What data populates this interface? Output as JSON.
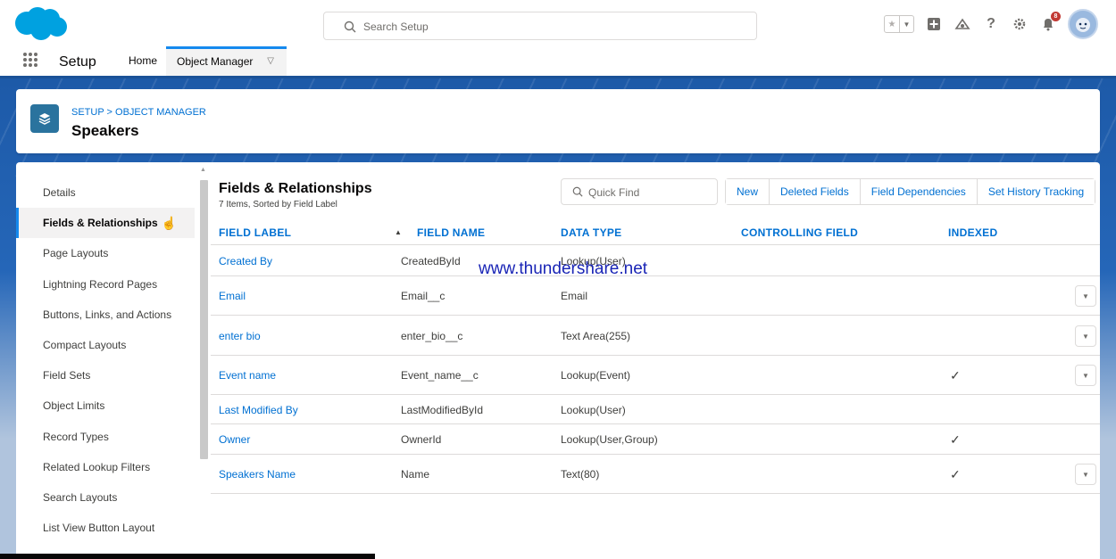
{
  "header": {
    "search_placeholder": "Search Setup",
    "notification_count": "8",
    "help_glyph": "?"
  },
  "nav": {
    "app_name": "Setup",
    "tabs": [
      {
        "label": "Home"
      },
      {
        "label": "Object Manager"
      }
    ]
  },
  "object_header": {
    "breadcrumb": "SETUP > OBJECT MANAGER",
    "title": "Speakers"
  },
  "sidebar": {
    "items": [
      {
        "label": "Details"
      },
      {
        "label": "Fields & Relationships"
      },
      {
        "label": "Page Layouts"
      },
      {
        "label": "Lightning Record Pages"
      },
      {
        "label": "Buttons, Links, and Actions"
      },
      {
        "label": "Compact Layouts"
      },
      {
        "label": "Field Sets"
      },
      {
        "label": "Object Limits"
      },
      {
        "label": "Record Types"
      },
      {
        "label": "Related Lookup Filters"
      },
      {
        "label": "Search Layouts"
      },
      {
        "label": "List View Button Layout"
      }
    ],
    "active_index": 1
  },
  "content": {
    "title": "Fields & Relationships",
    "subtitle": "7 Items, Sorted by Field Label",
    "quick_find_placeholder": "Quick Find",
    "buttons": {
      "new": "New",
      "deleted_fields": "Deleted Fields",
      "field_dependencies": "Field Dependencies",
      "history_tracking": "Set History Tracking"
    },
    "columns": {
      "field_label": "FIELD LABEL",
      "field_name": "FIELD NAME",
      "data_type": "DATA TYPE",
      "controlling_field": "CONTROLLING FIELD",
      "indexed": "INDEXED"
    },
    "rows": [
      {
        "label": "Created By",
        "name": "CreatedById",
        "type": "Lookup(User)",
        "indexed": "",
        "menu": false
      },
      {
        "label": "Email",
        "name": "Email__c",
        "type": "Email",
        "indexed": "",
        "menu": true
      },
      {
        "label": "enter bio",
        "name": "enter_bio__c",
        "type": "Text Area(255)",
        "indexed": "",
        "menu": true
      },
      {
        "label": "Event name",
        "name": "Event_name__c",
        "type": "Lookup(Event)",
        "indexed": "✓",
        "menu": true
      },
      {
        "label": "Last Modified By",
        "name": "LastModifiedById",
        "type": "Lookup(User)",
        "indexed": "",
        "menu": false
      },
      {
        "label": "Owner",
        "name": "OwnerId",
        "type": "Lookup(User,Group)",
        "indexed": "✓",
        "menu": false
      },
      {
        "label": "Speakers Name",
        "name": "Name",
        "type": "Text(80)",
        "indexed": "✓",
        "menu": true
      }
    ]
  },
  "watermark": "www.thundershare.net",
  "colors": {
    "brand_blue": "#1b5297",
    "link": "#0070d2",
    "accent": "#1589ee",
    "cloud": "#00a1e0"
  }
}
